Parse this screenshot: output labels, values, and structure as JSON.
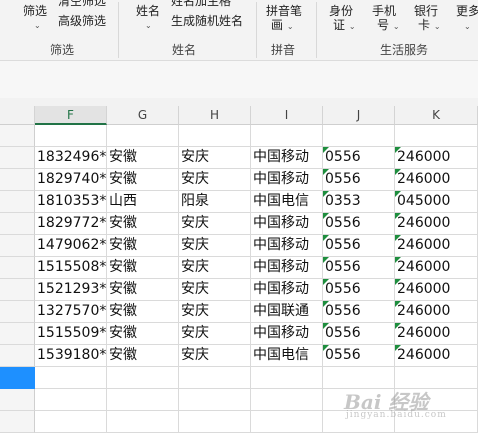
{
  "ribbon": {
    "filter_group": {
      "filter_label": "筛选",
      "clear_filter_label": "清空筛选",
      "advanced_filter_label": "高级筛选",
      "group_label": "筛选"
    },
    "name_group": {
      "name_label": "姓名",
      "name_add_label": "姓名加生格",
      "random_name_label": "生成随机姓名",
      "group_label": "姓名"
    },
    "pinyin_group": {
      "pinyin_label_1": "拼音笔",
      "pinyin_label_2": "画",
      "group_label": "拼音"
    },
    "life_group": {
      "id_label_1": "身份",
      "id_label_2": "证",
      "phone_label_1": "手机",
      "phone_label_2": "号",
      "bank_label_1": "银行",
      "bank_label_2": "卡",
      "more_label": "更多",
      "group_label": "生活服务"
    }
  },
  "columns": [
    "F",
    "G",
    "H",
    "I",
    "J",
    "K"
  ],
  "active_column": "F",
  "rows": [
    {
      "phone": "1832496*",
      "province": "安徽",
      "city": "安庆",
      "carrier": "中国移动",
      "area_code": "0556",
      "postcode": "246000"
    },
    {
      "phone": "1829740*",
      "province": "安徽",
      "city": "安庆",
      "carrier": "中国移动",
      "area_code": "0556",
      "postcode": "246000"
    },
    {
      "phone": "1810353*",
      "province": "山西",
      "city": "阳泉",
      "carrier": "中国电信",
      "area_code": "0353",
      "postcode": "045000"
    },
    {
      "phone": "1829772*",
      "province": "安徽",
      "city": "安庆",
      "carrier": "中国移动",
      "area_code": "0556",
      "postcode": "246000"
    },
    {
      "phone": "1479062*",
      "province": "安徽",
      "city": "安庆",
      "carrier": "中国移动",
      "area_code": "0556",
      "postcode": "246000"
    },
    {
      "phone": "1515508*",
      "province": "安徽",
      "city": "安庆",
      "carrier": "中国移动",
      "area_code": "0556",
      "postcode": "246000"
    },
    {
      "phone": "1521293*",
      "province": "安徽",
      "city": "安庆",
      "carrier": "中国移动",
      "area_code": "0556",
      "postcode": "246000"
    },
    {
      "phone": "1327570*",
      "province": "安徽",
      "city": "安庆",
      "carrier": "中国联通",
      "area_code": "0556",
      "postcode": "246000"
    },
    {
      "phone": "1515509*",
      "province": "安徽",
      "city": "安庆",
      "carrier": "中国移动",
      "area_code": "0556",
      "postcode": "246000"
    },
    {
      "phone": "1539180*",
      "province": "安徽",
      "city": "安庆",
      "carrier": "中国电信",
      "area_code": "0556",
      "postcode": "246000"
    }
  ],
  "watermark": {
    "text": "Bai 经验",
    "sub": "jingyan.baidu.com"
  },
  "colors": {
    "selection_blue": "#1e90ff",
    "accent_green": "#217346",
    "text_number_flag": "#1e8e3e"
  }
}
